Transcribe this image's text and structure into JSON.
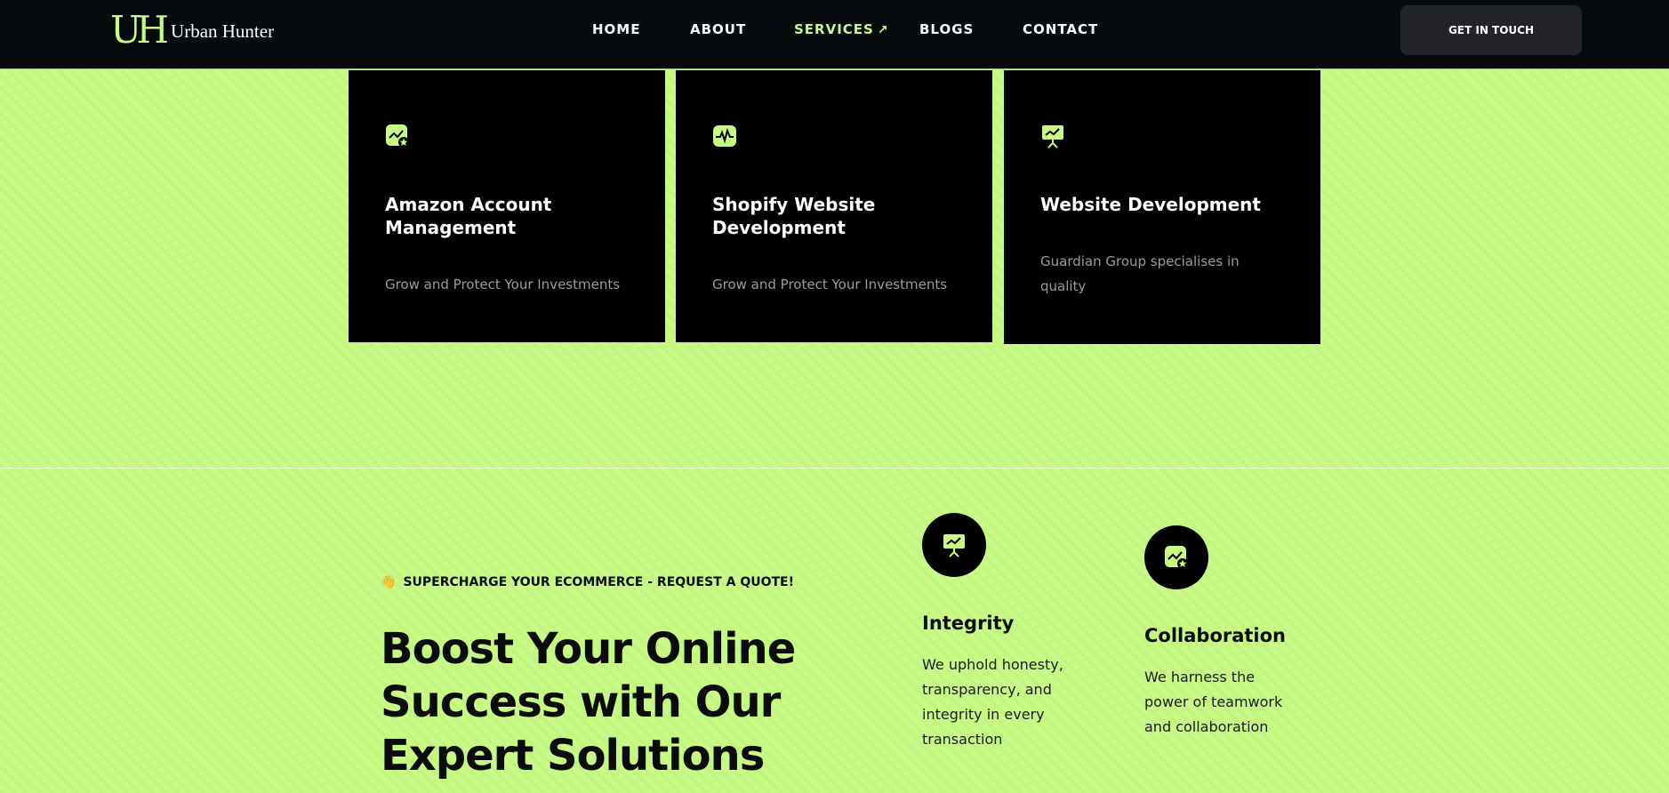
{
  "brand": {
    "mark": "UH",
    "name": "Urban Hunter"
  },
  "nav": [
    {
      "label": "HOME"
    },
    {
      "label": "ABOUT"
    },
    {
      "label": "SERVICES",
      "arrow": "↗"
    },
    {
      "label": "BLOGS"
    },
    {
      "label": "CONTACT"
    }
  ],
  "cta": {
    "label": "GET IN TOUCH"
  },
  "services": [
    {
      "title": "Amazon Account Management",
      "description": "Grow and Protect Your Investments",
      "icon": "chart-badge-icon"
    },
    {
      "title": "Shopify Website Development",
      "description": "Grow and Protect Your Investments",
      "icon": "pulse-icon"
    },
    {
      "title": "Website Development",
      "description": "Guardian Group specialises in quality",
      "icon": "presentation-icon"
    }
  ],
  "promo": {
    "eyebrow_emoji": "👋",
    "eyebrow": "SUPERCHARGE YOUR ECOMMERCE - REQUEST A QUOTE!",
    "headline": "Boost Your Online Success with Our Expert Solutions"
  },
  "values": [
    {
      "title": "Integrity",
      "description": "We uphold honesty, transparency, and integrity in every transaction",
      "icon": "presentation-icon"
    },
    {
      "title": "Collaboration",
      "description": "We harness the power of teamwork and collaboration",
      "icon": "chart-badge-icon"
    }
  ],
  "colors": {
    "accent": "#c8f985",
    "dark": "#070b0d",
    "card": "#000000",
    "muted": "#9c9c9c"
  }
}
